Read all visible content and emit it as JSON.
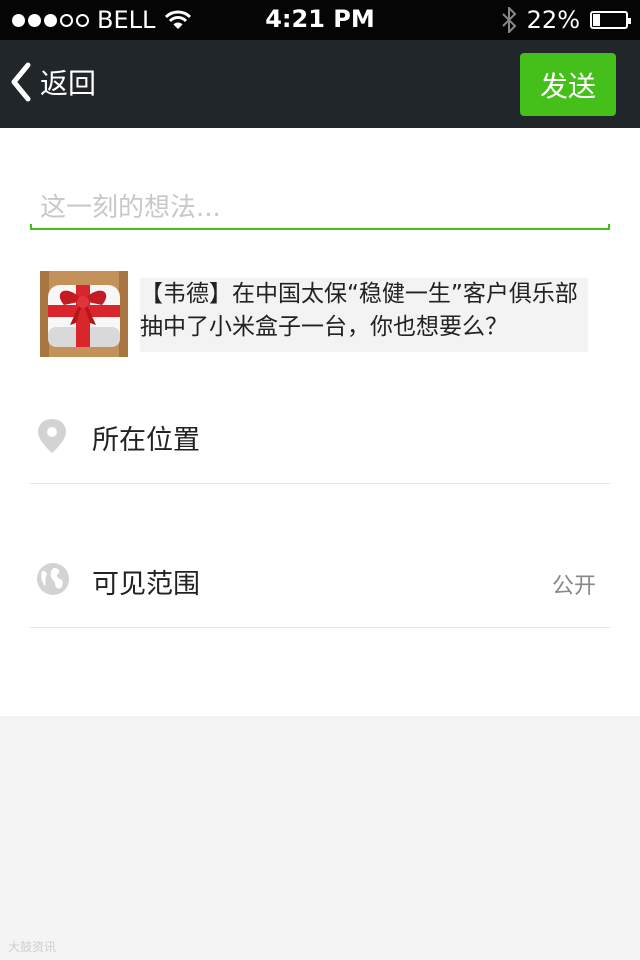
{
  "status_bar": {
    "carrier": "BELL",
    "time": "4:21 PM",
    "battery": "22%",
    "battery_level": 0.22,
    "signal_bars": 3,
    "signal_total": 5,
    "icons": [
      "wifi-icon",
      "bluetooth-icon",
      "battery-icon"
    ]
  },
  "nav": {
    "back_label": "返回",
    "send_label": "发送"
  },
  "composer": {
    "placeholder": "这一刻的想法..."
  },
  "share_card": {
    "text": "【韦德】在中国太保“稳健一生”客户俱乐部抽中了小米盒子一台，你也想要么？",
    "thumbnail_icon": "gift-box-icon"
  },
  "options": {
    "location_label": "所在位置",
    "visibility_label": "可见范围",
    "visibility_value": "公开"
  },
  "colors": {
    "accent": "#45c01a",
    "nav_bg": "#202629"
  },
  "watermark": "大鼓资讯"
}
